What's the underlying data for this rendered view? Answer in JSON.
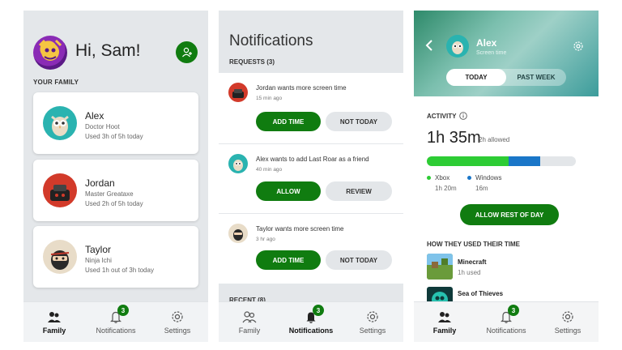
{
  "colors": {
    "accent": "#107c10",
    "bar_xbox": "#2dcc34",
    "bar_windows": "#1a76c8",
    "bar_track": "#e3e6e9"
  },
  "tabbar": {
    "family": "Family",
    "notifications": "Notifications",
    "settings": "Settings",
    "badge_count": "3"
  },
  "home": {
    "greeting": "Hi, Sam!",
    "section": "YOUR FAMILY",
    "members": [
      {
        "name": "Alex",
        "gamertag": "Doctor Hoot",
        "usage": "Used 3h of 5h today"
      },
      {
        "name": "Jordan",
        "gamertag": "Master Greataxe",
        "usage": "Used 2h of 5h today"
      },
      {
        "name": "Taylor",
        "gamertag": "Ninja Ichi",
        "usage": "Used 1h out of 3h today"
      }
    ]
  },
  "notifications": {
    "title": "Notifications",
    "requests_header": "REQUESTS (3)",
    "recent_header": "RECENT (8)",
    "requests": [
      {
        "text": "Jordan wants more screen time",
        "time": "15 min ago",
        "primary": "ADD TIME",
        "secondary": "NOT TODAY"
      },
      {
        "text": "Alex wants to add Last Roar as a friend",
        "time": "40 min ago",
        "primary": "ALLOW",
        "secondary": "REVIEW"
      },
      {
        "text": "Taylor wants more screen time",
        "time": "3 hr ago",
        "primary": "ADD TIME",
        "secondary": "NOT TODAY"
      }
    ]
  },
  "detail": {
    "name": "Alex",
    "subtitle": "Screen time",
    "seg_today": "TODAY",
    "seg_week": "PAST WEEK",
    "activity_label": "ACTIVITY",
    "total_used": "1h 35m",
    "allowed": "2h allowed",
    "xbox_label": "Xbox",
    "xbox_time": "1h 20m",
    "windows_label": "Windows",
    "windows_time": "16m",
    "xbox_fraction": 0.55,
    "windows_fraction": 0.21,
    "allow_button": "ALLOW REST OF DAY",
    "usage_header": "HOW THEY USED THEIR TIME",
    "games": [
      {
        "name": "Minecraft",
        "used": "1h used"
      },
      {
        "name": "Sea of Thieves",
        "used": ""
      }
    ]
  }
}
